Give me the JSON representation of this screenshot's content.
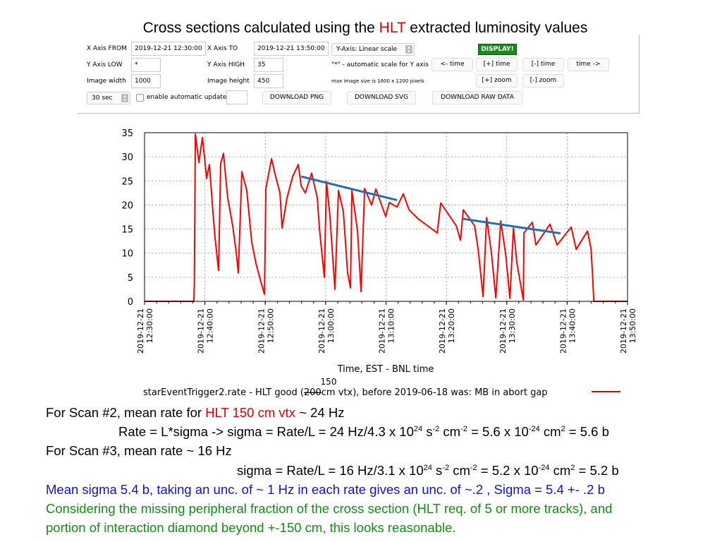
{
  "title": {
    "pre": "Cross sections calculated using the ",
    "hlt": "HLT",
    "post": " extracted luminosity values"
  },
  "panel": {
    "x_from_label": "X Axis FROM",
    "x_from_value": "2019-12-21 12:30:00",
    "x_to_label": "X Axis TO",
    "x_to_value": "2019-12-21 13:50:00",
    "yaxis_select": "Y-Axis: Linear scale",
    "display_button": "DISPLAY!",
    "y_low_label": "Y Axis LOW",
    "y_low_value": "*",
    "y_high_label": "Y Axis HIGH",
    "y_high_value": "35",
    "auto_scale_note": "\"*\" - automatic scale for Y axis",
    "time_back": "<- time",
    "time_plus": "[+] time",
    "time_minus": "[-] time",
    "time_fwd": "time ->",
    "width_label": "Image width",
    "width_value": "1000",
    "height_label": "Image height",
    "height_value": "450",
    "max_size_note": "max image size is 1600 x 1200 pixels",
    "zoom_plus": "[+] zoom",
    "zoom_minus": "[-] zoom",
    "interval_select": "30 sec",
    "auto_update_label": "enable automatic update",
    "download_png": "DOWNLOAD PNG",
    "download_svg": "DOWNLOAD SVG",
    "download_raw": "DOWNLOAD RAW DATA"
  },
  "chart_data": {
    "type": "line",
    "xlabel": "Time, EST - BNL time",
    "ylim": [
      0,
      35
    ],
    "yticks": [
      "0",
      "5",
      "10",
      "15",
      "20",
      "25",
      "30",
      "35"
    ],
    "xticks": [
      [
        "2019-12-21",
        "12:30:00"
      ],
      [
        "2019-12-21",
        "12:40:00"
      ],
      [
        "2019-12-21",
        "12:50:00"
      ],
      [
        "2019-12-21",
        "13:00:00"
      ],
      [
        "2019-12-21",
        "13:10:00"
      ],
      [
        "2019-12-21",
        "13:20:00"
      ],
      [
        "2019-12-21",
        "13:30:00"
      ],
      [
        "2019-12-21",
        "13:40:00"
      ],
      [
        "2019-12-21",
        "13:50:00"
      ]
    ],
    "xlim": [
      "12:30:00",
      "13:50:00"
    ],
    "grid": true,
    "legend": {
      "text_pre": "starEventTrigger2.rate - HLT good (",
      "struck": "200",
      "inserted": "150",
      "text_post": "cm vtx), before 2019-06-18 was: MB in abort gap",
      "position": "bottom"
    },
    "series": [
      {
        "color": "#ff0000",
        "points": [
          [
            "12:30:00",
            0
          ],
          [
            "12:38:10",
            0
          ],
          [
            "12:38:15",
            3.2
          ],
          [
            "12:38:25",
            34.7
          ],
          [
            "12:39:00",
            28.8
          ],
          [
            "12:39:35",
            34
          ],
          [
            "12:40:17",
            25.5
          ],
          [
            "12:40:45",
            28.4
          ],
          [
            "12:41:20",
            18.6
          ],
          [
            "12:41:41",
            13.2
          ],
          [
            "12:42:16",
            6.4
          ],
          [
            "12:42:37",
            28.6
          ],
          [
            "12:43:05",
            30.7
          ],
          [
            "12:43:26",
            25.9
          ],
          [
            "12:43:47",
            21.5
          ],
          [
            "12:44:36",
            15.7
          ],
          [
            "12:45:11",
            10.2
          ],
          [
            "12:45:32",
            5.9
          ],
          [
            "12:46:07",
            26.9
          ],
          [
            "12:46:56",
            23
          ],
          [
            "12:47:45",
            12.3
          ],
          [
            "12:48:27",
            7.9
          ],
          [
            "12:49:17",
            4
          ],
          [
            "12:49:52",
            1.5
          ],
          [
            "12:50:06",
            23.4
          ],
          [
            "12:51:02",
            29.6
          ],
          [
            "12:51:37",
            26.4
          ],
          [
            "12:52:26",
            22.5
          ],
          [
            "12:52:47",
            15.2
          ],
          [
            "12:53:36",
            21.5
          ],
          [
            "12:54:32",
            25.9
          ],
          [
            "12:55:28",
            28.4
          ],
          [
            "12:55:56",
            24
          ],
          [
            "12:56:38",
            22.5
          ],
          [
            "12:57:41",
            26.6
          ],
          [
            "12:58:37",
            21.5
          ],
          [
            "12:58:58",
            15.2
          ],
          [
            "12:59:47",
            5
          ],
          [
            "13:00:08",
            24.9
          ],
          [
            "13:00:43",
            17.6
          ],
          [
            "13:01:32",
            2.5
          ],
          [
            "13:02:08",
            23
          ],
          [
            "13:02:56",
            18.6
          ],
          [
            "13:03:38",
            5.9
          ],
          [
            "13:04:07",
            2.8
          ],
          [
            "13:04:21",
            23
          ],
          [
            "13:05:17",
            14.6
          ],
          [
            "13:05:52",
            2
          ],
          [
            "13:06:27",
            23.4
          ],
          [
            "13:07:37",
            20
          ],
          [
            "13:08:19",
            23.3
          ],
          [
            "13:09:57",
            17.6
          ],
          [
            "13:10:32",
            20.5
          ],
          [
            "13:11:49",
            19.6
          ],
          [
            "13:12:52",
            22.3
          ],
          [
            "13:13:49",
            19
          ],
          [
            "13:15:20",
            17.1
          ],
          [
            "13:18:29",
            14.2
          ],
          [
            "13:19:04",
            20.4
          ],
          [
            "13:21:38",
            15.7
          ],
          [
            "13:22:20",
            12.7
          ],
          [
            "13:22:48",
            19
          ],
          [
            "13:24:40",
            15.7
          ],
          [
            "13:25:16",
            10.8
          ],
          [
            "13:26:04",
            1
          ],
          [
            "13:26:40",
            17.4
          ],
          [
            "13:27:29",
            9.8
          ],
          [
            "13:28:11",
            0.7
          ],
          [
            "13:29:00",
            16.7
          ],
          [
            "13:29:49",
            9.8
          ],
          [
            "13:30:31",
            0.6
          ],
          [
            "13:31:06",
            15.2
          ],
          [
            "13:31:41",
            7.9
          ],
          [
            "13:32:44",
            0.3
          ],
          [
            "13:32:51",
            14.2
          ],
          [
            "13:34:15",
            16.4
          ],
          [
            "13:34:50",
            11.7
          ],
          [
            "13:37:10",
            16
          ],
          [
            "13:38:20",
            11.7
          ],
          [
            "13:40:41",
            15.4
          ],
          [
            "13:41:30",
            10.8
          ],
          [
            "13:43:22",
            14.6
          ],
          [
            "13:43:57",
            11
          ],
          [
            "13:44:11",
            6.1
          ],
          [
            "13:44:25",
            0
          ],
          [
            "13:50:00",
            0
          ]
        ]
      },
      {
        "color": "#1f6fb5",
        "points": [
          [
            "12:55:56",
            25.9
          ],
          [
            "13:11:49",
            21.0
          ]
        ]
      },
      {
        "color": "#1f6fb5",
        "points": [
          [
            "13:22:48",
            17.1
          ],
          [
            "13:38:55",
            14.1
          ]
        ]
      }
    ]
  },
  "notes": {
    "l1_pre": "For Scan #2, mean rate for ",
    "l1_red": "HLT 150 cm vtx",
    "l1_post": " ~ 24 Hz",
    "l2_a": "Rate = L*sigma -> sigma = Rate/L = 24 Hz/4.3 x 10",
    "l2_e1": "24",
    "l2_b": " s",
    "l2_e2": "-2",
    "l2_c": " cm",
    "l2_e3": "-2",
    "l2_d": " = 5.6 x 10",
    "l2_e4": "-24",
    "l2_f": " cm",
    "l2_e5": "2",
    "l2_g": " = 5.6 b",
    "l3": "For Scan #3, mean rate ~ 16 Hz",
    "l4_a": "sigma = Rate/L =   16 Hz/3.1 x 10",
    "l4_e1": "24",
    "l4_b": " s",
    "l4_e2": "-2",
    "l4_c": " cm",
    "l4_e3": "-2",
    "l4_d": " = 5.2 x 10",
    "l4_e4": "-24",
    "l4_f": " cm",
    "l4_e5": "2",
    "l4_g": " = 5.2 b",
    "l5": "Mean sigma 5.4 b, taking an unc. of ~ 1 Hz in each rate gives an unc. of ~.2 , Sigma = 5.4 +- .2 b",
    "l6": "Considering the missing peripheral fraction of the cross section (HLT req. of 5 or more tracks), and",
    "l7": "portion of interaction diamond beyond +-150 cm, this looks reasonable."
  }
}
